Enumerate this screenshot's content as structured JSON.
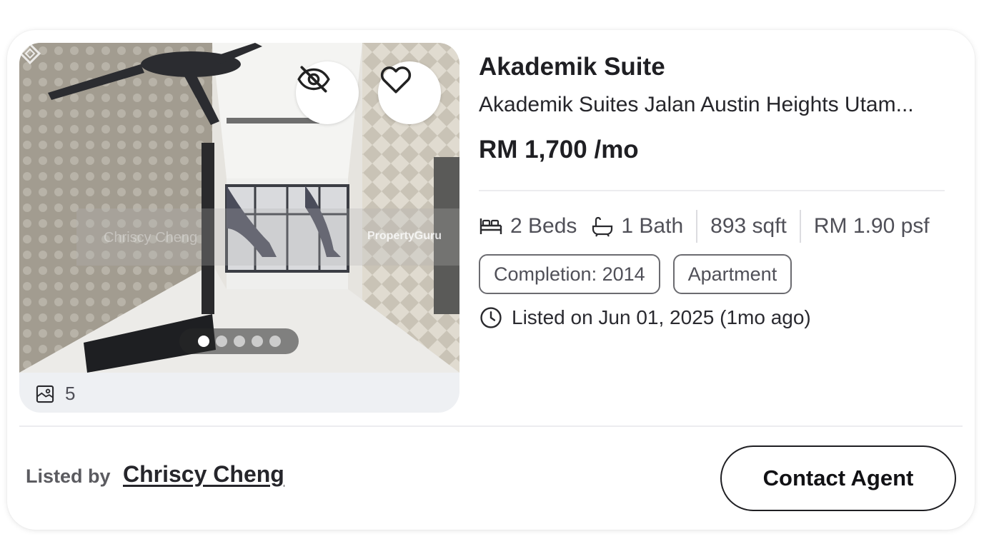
{
  "listing": {
    "title": "Akademik Suite",
    "address": "Akademik Suites Jalan Austin Heights Utam...",
    "price": "RM 1,700 /mo",
    "beds": "2 Beds",
    "baths": "1 Bath",
    "size": "893 sqft",
    "psf": "RM 1.90 psf",
    "tags": [
      "Completion: 2014",
      "Apartment"
    ],
    "listed_on": "Listed on Jun 01, 2025 (1mo ago)"
  },
  "gallery": {
    "photo_count": "5",
    "total_slides": 5,
    "active_slide": 1,
    "watermark_left": "Chriscy Cheng",
    "watermark_right": "PropertyGuru"
  },
  "agent": {
    "listed_by_label": "Listed by",
    "name": "Chriscy Cheng",
    "contact_label": "Contact Agent"
  },
  "icons": {
    "hide": "eye-off-icon",
    "favorite": "heart-icon",
    "gallery": "image-icon",
    "bed": "bed-icon",
    "bath": "bathtub-icon",
    "time": "clock-icon"
  }
}
